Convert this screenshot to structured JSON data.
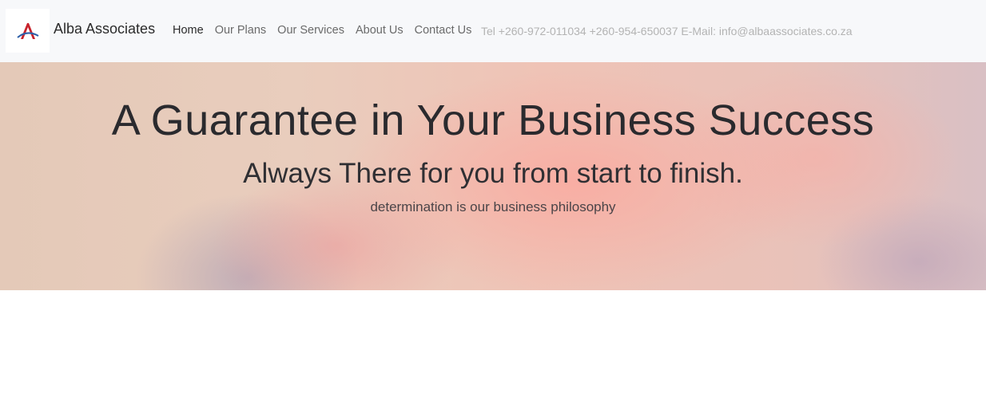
{
  "navbar": {
    "brand": "Alba Associates",
    "logo_icon": "alba-a-logo-icon",
    "links": [
      {
        "label": "Home",
        "active": true
      },
      {
        "label": "Our Plans",
        "active": false
      },
      {
        "label": "Our Services",
        "active": false
      },
      {
        "label": "About Us",
        "active": false
      },
      {
        "label": "Contact Us",
        "active": false
      }
    ],
    "contact_text": "Tel +260-972-011034 +260-954-650037 E-Mail: info@albaassociates.co.za"
  },
  "hero": {
    "title": "A Guarantee in Your Business Success",
    "subtitle": "Always There for you from start to finish.",
    "tagline": "determination is our business philosophy"
  },
  "colors": {
    "navbar_bg": "#f7f8fa",
    "logo_red": "#c8232c",
    "logo_blue": "#2d5fa8",
    "text_dark": "#2b2b2b",
    "text_muted": "#b3b3b3"
  }
}
